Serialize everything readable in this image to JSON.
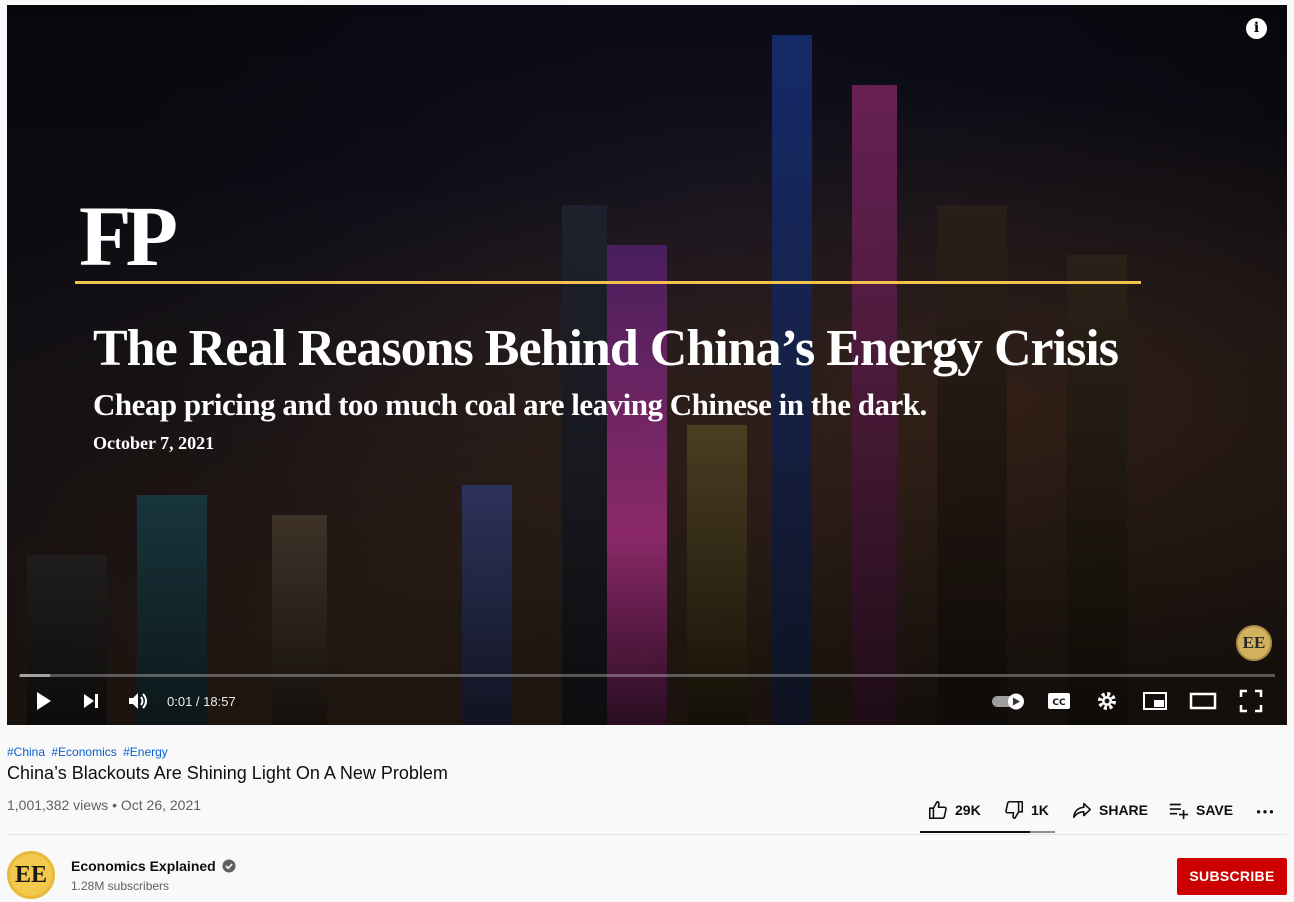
{
  "player": {
    "frame": {
      "logo": "FP",
      "headline": "The Real Reasons Behind China’s Energy Crisis",
      "subhead": "Cheap pricing and too much coal are leaving Chinese in the dark.",
      "date": "October 7, 2021",
      "watermark": "EE"
    },
    "info_label": "i",
    "time_display": "0:01 / 18:57",
    "progress": 0.001,
    "loaded": 0.025,
    "autoplay_on": true
  },
  "video": {
    "hashtags": [
      "#China",
      "#Economics",
      "#Energy"
    ],
    "title": "China’s Blackouts Are Shining Light On A New Problem",
    "meta": "1,001,382 views • Oct 26, 2021"
  },
  "actions": {
    "like_count": "29K",
    "dislike_count": "1K",
    "share_label": "SHARE",
    "save_label": "SAVE"
  },
  "channel": {
    "avatar_text": "EE",
    "name": "Economics Explained",
    "subscribers": "1.28M subscribers",
    "subscribe_label": "SUBSCRIBE"
  },
  "colors": {
    "accent_gold": "#f2c14e",
    "subscribe_red": "#cc0000",
    "hashtag_blue": "#065fd4"
  }
}
